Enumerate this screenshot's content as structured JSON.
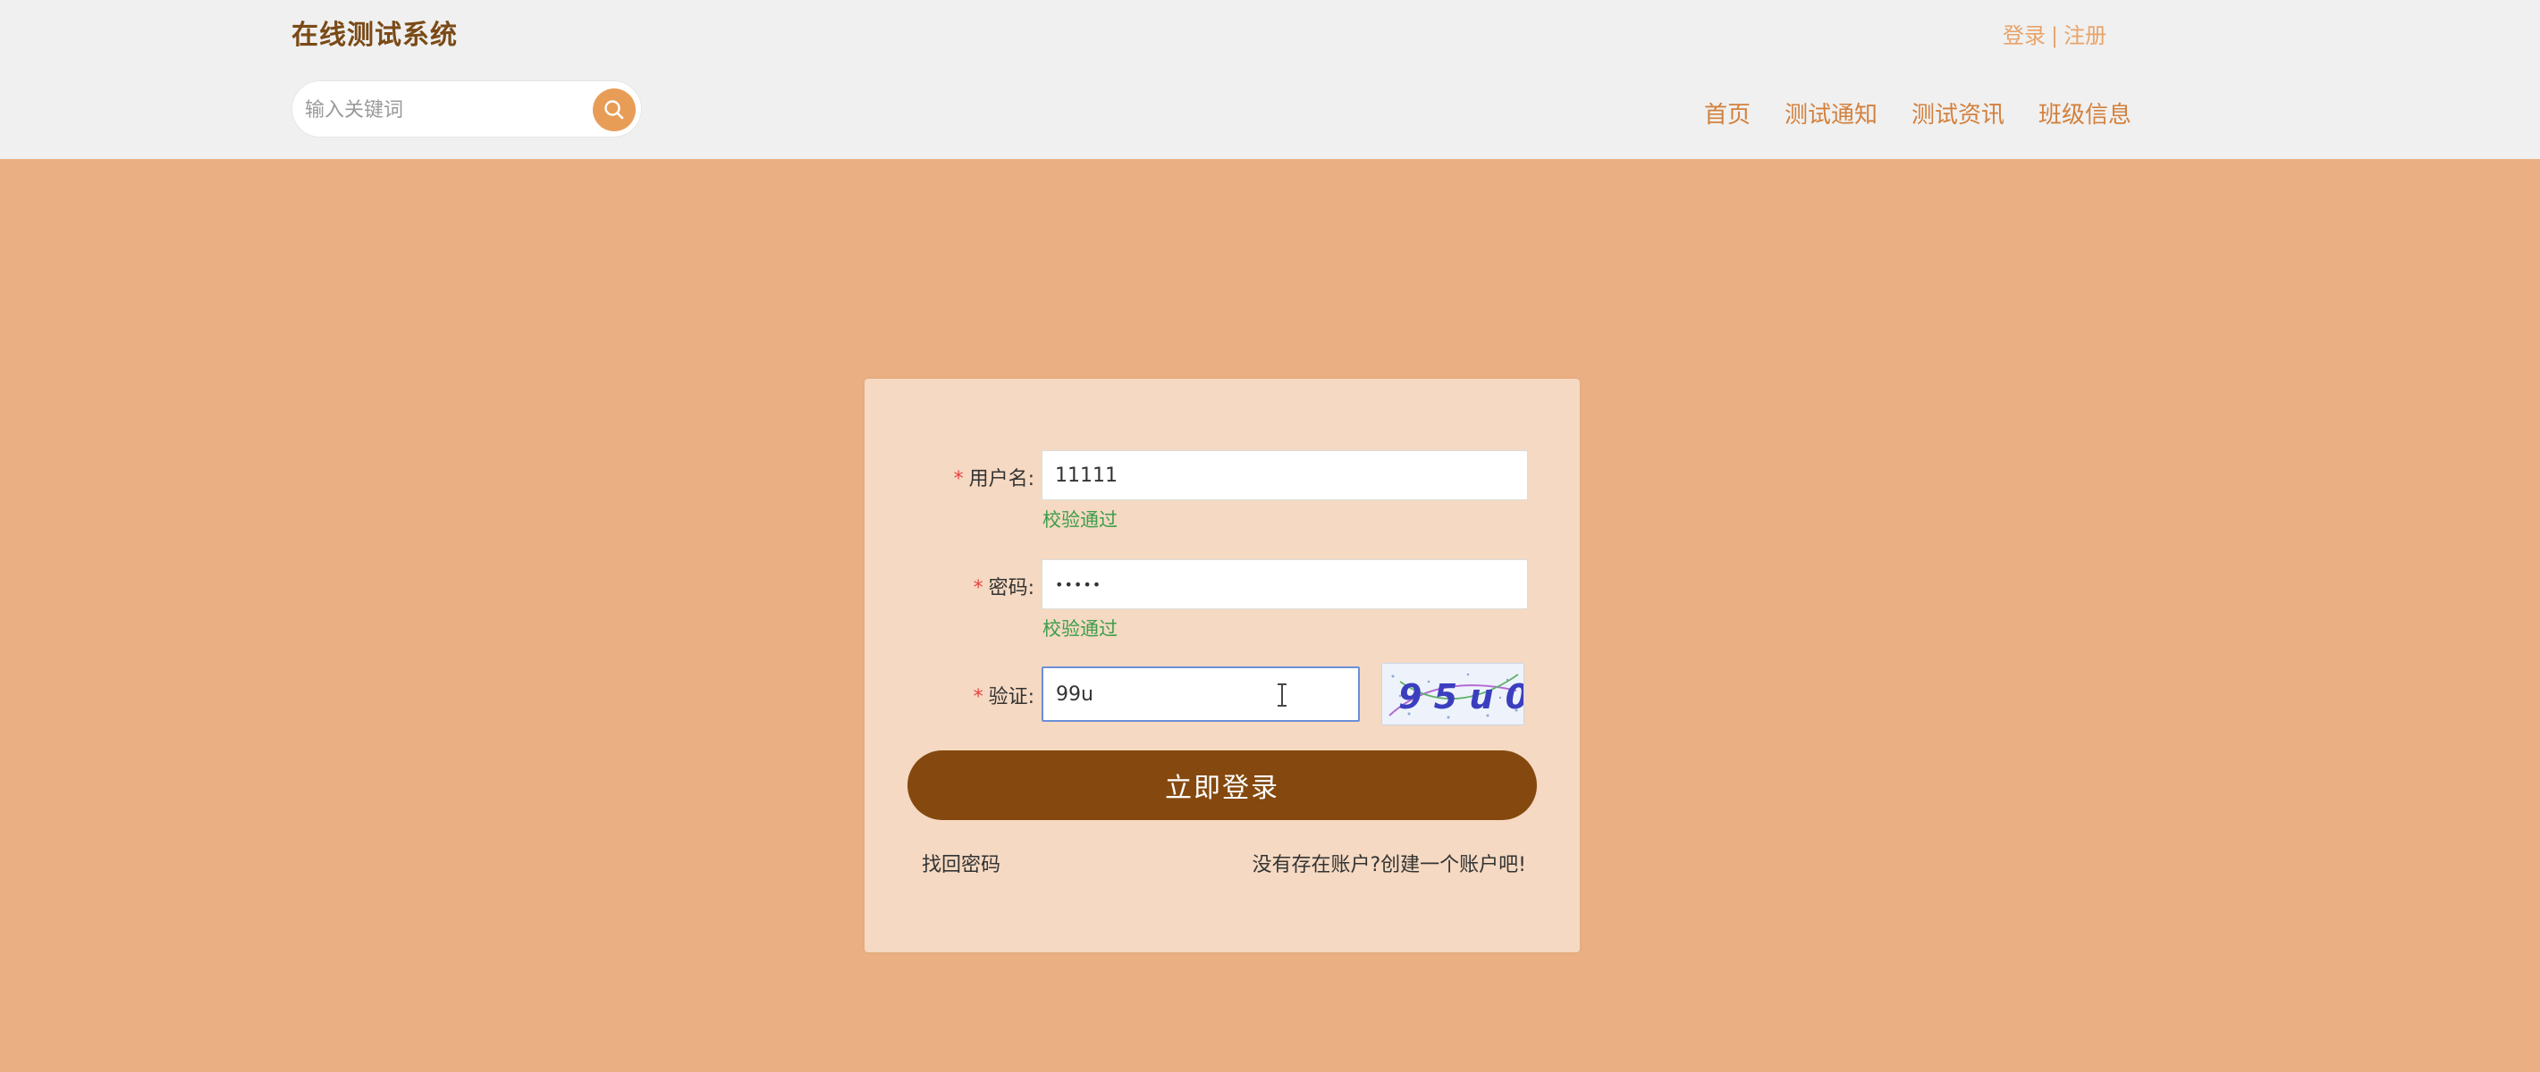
{
  "header": {
    "site_title": "在线测试系统",
    "login_link": "登录",
    "separator": "|",
    "register_link": "注册",
    "search": {
      "placeholder": "输入关键词",
      "value": "",
      "button_icon": "search-icon"
    },
    "nav": [
      {
        "label": "首页"
      },
      {
        "label": "测试通知"
      },
      {
        "label": "测试资讯"
      },
      {
        "label": "班级信息"
      }
    ]
  },
  "login_form": {
    "required_mark": "*",
    "username": {
      "label": "用户名:",
      "value": "11111",
      "hint": "校验通过"
    },
    "password": {
      "label": "密码:",
      "value": "•••••",
      "hint": "校验通过"
    },
    "captcha": {
      "label": "验证:",
      "value": "99u",
      "image_text": "9 5 u 0"
    },
    "submit_label": "立即登录",
    "forgot_password": "找回密码",
    "create_account": "没有存在账户?创建一个账户吧!"
  },
  "colors": {
    "page_background": "#eab083",
    "header_background": "#f0f0f0",
    "card_background": "#f5d9c2",
    "accent": "#e89d57",
    "button": "#85490f",
    "title": "#7a4a17",
    "nav_link": "#d3803d",
    "success_hint": "#3c9e4b",
    "required_star": "#e64340"
  }
}
